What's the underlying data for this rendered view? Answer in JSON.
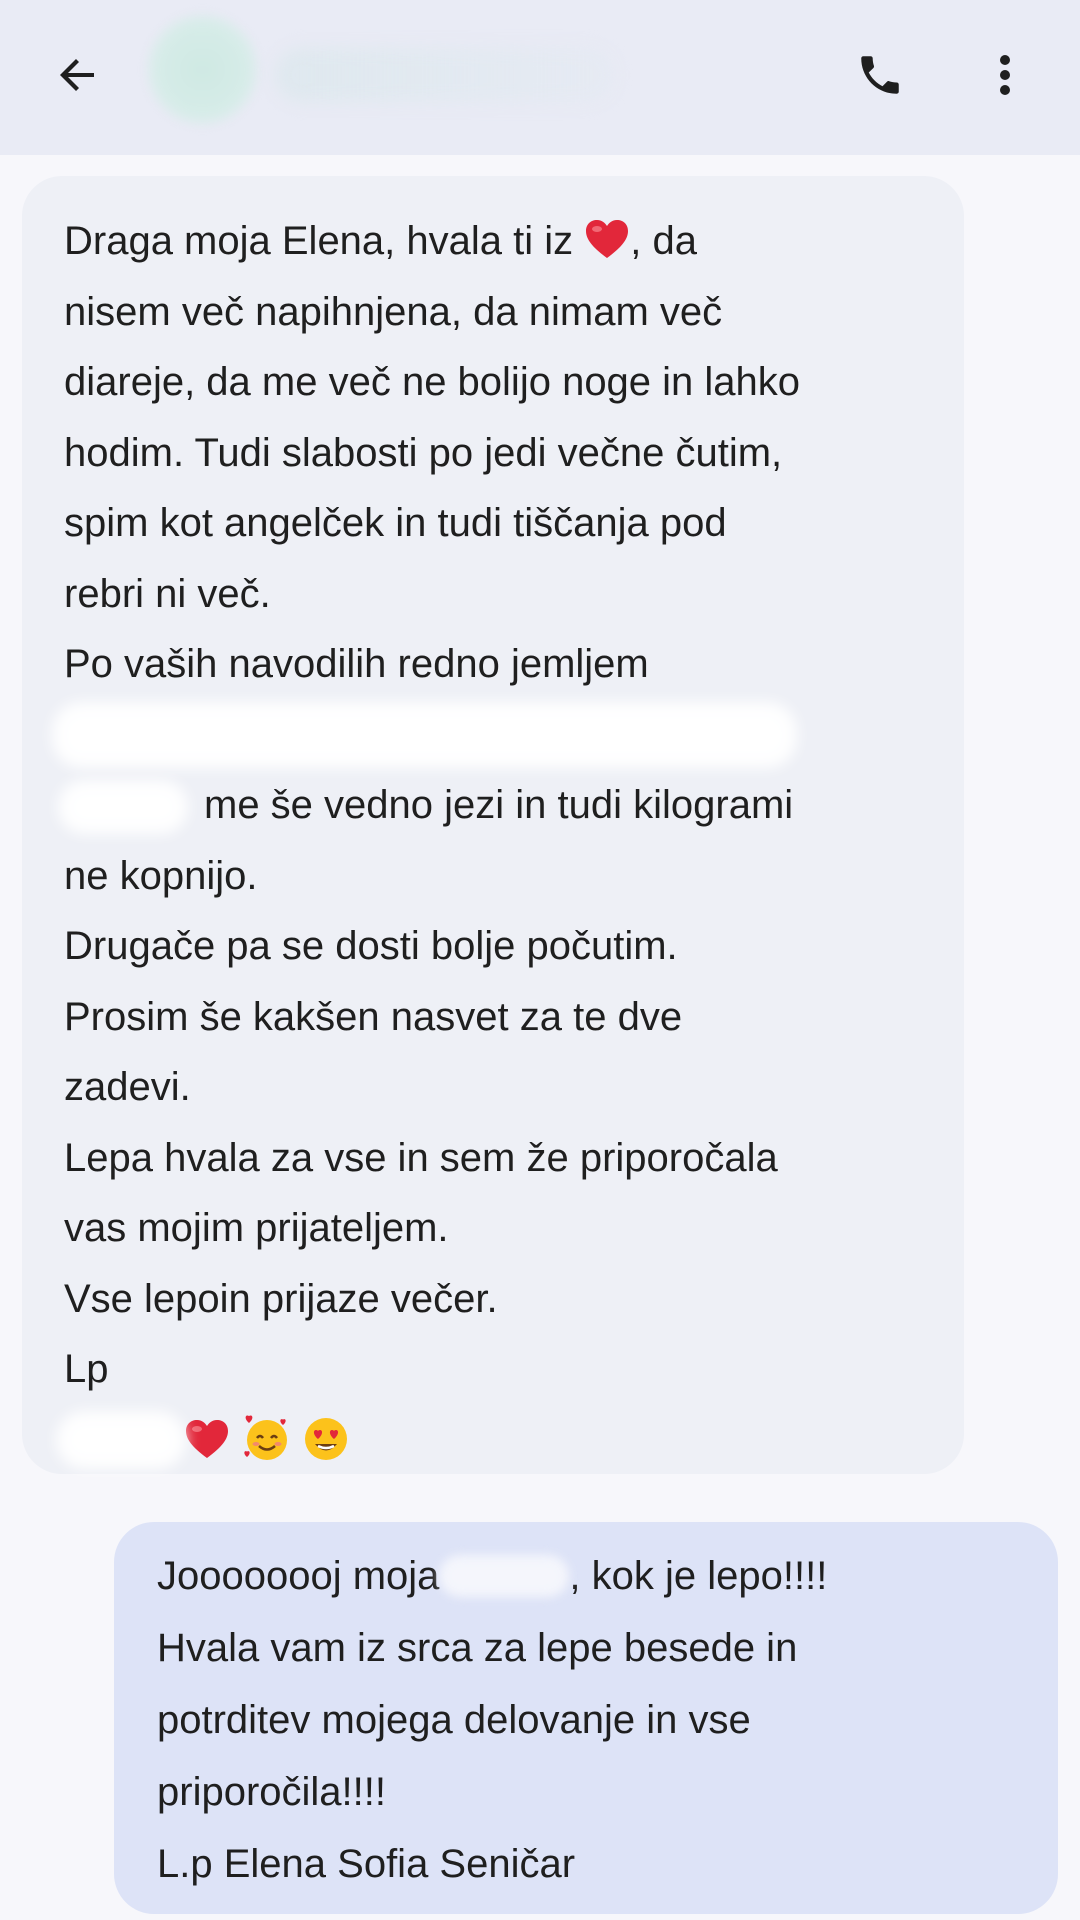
{
  "header": {
    "back_icon": "arrow-left-icon",
    "call_icon": "phone-icon",
    "more_icon": "more-vert-icon"
  },
  "incoming_message": {
    "line1_a": "Draga moja Elena, hvala ti iz ",
    "line1_b": ", da",
    "line2": "nisem več napihnjena, da nimam več",
    "line3": "diareje, da me več ne bolijo noge in lahko",
    "line4": "hodim.  Tudi slabosti po jedi večne čutim,",
    "line5": "spim kot angelček in tudi tiščanja pod",
    "line6": "rebri ni več.",
    "line7": "Po vaših navodilih redno jemljem",
    "line9": "me še vedno jezi in tudi kilogrami",
    "line10": "ne kopnijo.",
    "line11": "Drugače pa se dosti bolje počutim.",
    "line12": "Prosim še kakšen nasvet za te dve",
    "line13": "zadevi.",
    "line14": "Lepa hvala za vse in sem že priporočala",
    "line15": "vas mojim prijateljem.",
    "line16": "Vse lepoin prijaze večer.",
    "line17": "Lp",
    "signature_emojis": [
      "heart",
      "smiling-face-with-hearts",
      "heart-eyes"
    ]
  },
  "outgoing_message": {
    "line1_a": "Joooooooj moja",
    "line1_b": ", kok je lepo!!!!",
    "line2": "Hvala vam iz srca za lepe besede in",
    "line3": "potrditev mojega delovanje in vse",
    "line4": "priporočila!!!!",
    "line5": "L.p Elena Sofia Seničar"
  },
  "colors": {
    "header_bg": "#e9ebf5",
    "incoming_bg": "#eef0f6",
    "outgoing_bg": "#dde3f7",
    "heart": "#e2273a"
  }
}
